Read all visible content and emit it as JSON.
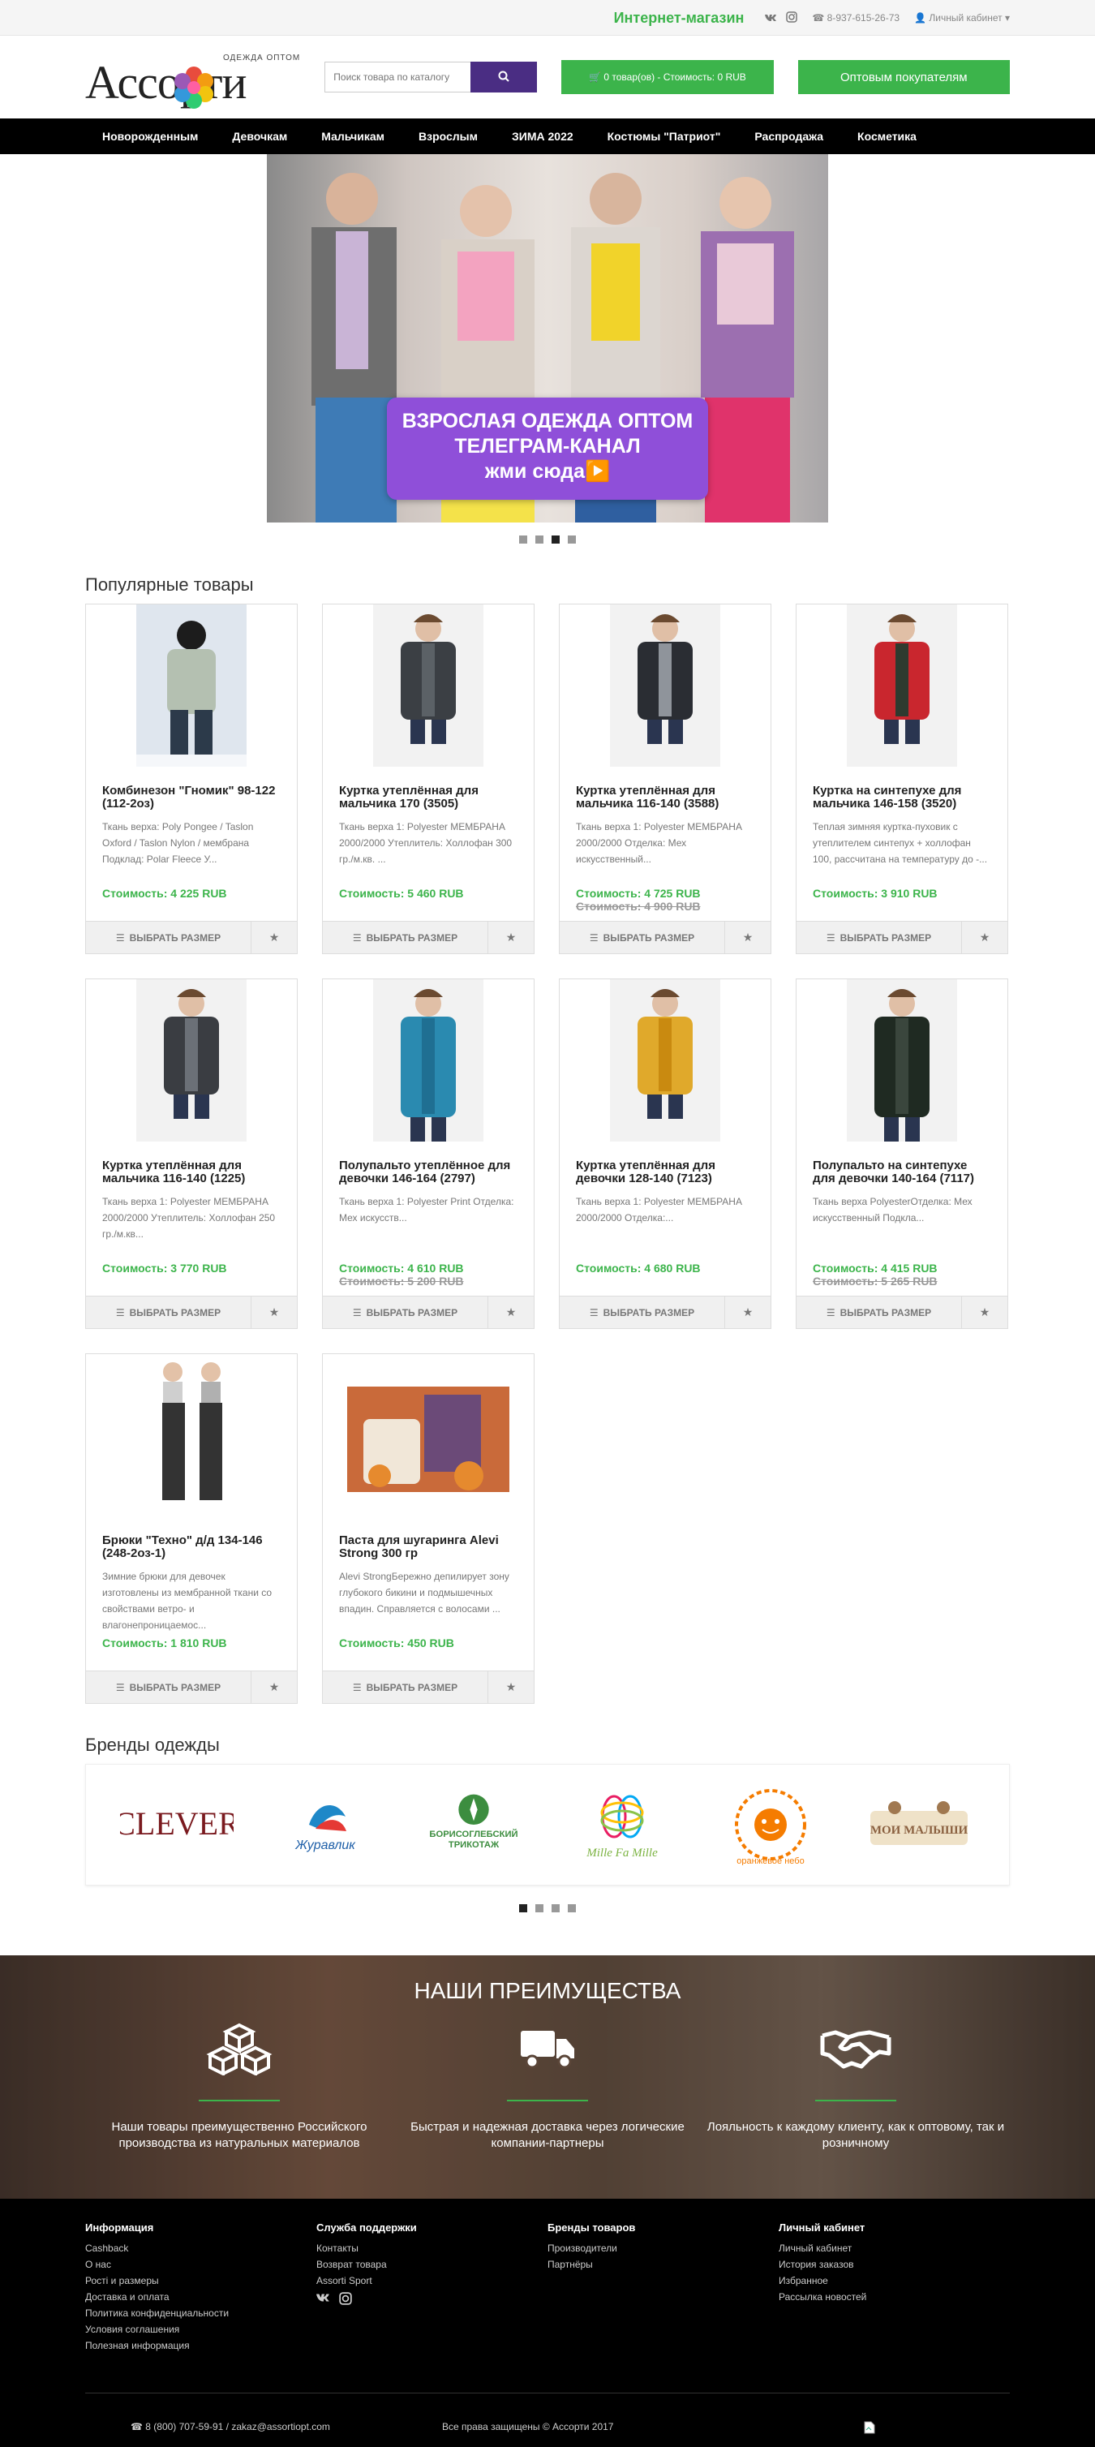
{
  "topbar": {
    "shop_title": "Интернет-магазин",
    "phone": "8-937-615-26-73",
    "cabinet": "Личный кабинет"
  },
  "header": {
    "logo_main": "Ассорти",
    "logo_sub": "ОДЕЖДА ОПТОМ",
    "search_placeholder": "Поиск товара по каталогу",
    "cart": "0 товар(ов) - Стоимость: 0 RUB",
    "wholesale": "Оптовым покупателям"
  },
  "nav": [
    "Новорожденным",
    "Девочкам",
    "Мальчикам",
    "Взрослым",
    "ЗИМА 2022",
    "Костюмы \"Патриот\"",
    "Распродажа",
    "Косметика"
  ],
  "banner": {
    "line1": "ВЗРОСЛАЯ ОДЕЖДА ОПТОМ",
    "line2": "ТЕЛЕГРАМ-КАНАЛ",
    "line3": "жми сюда▶️",
    "slide_count": 4,
    "active_slide": 3
  },
  "popular": {
    "title": "Популярные товары",
    "pick_label": "ВЫБРАТЬ РАЗМЕР",
    "products": [
      {
        "title": "Комбинезон \"Гномик\" 98-122 (112-2оз)",
        "desc": "Ткань верха: Poly Pongee / Taslon Oxford / Taslon Nylon / мембрана Подклад: Polar Fleece У...",
        "price": "Стоимость: 4 225 RUB",
        "old": ""
      },
      {
        "title": "Куртка утеплённая для мальчика 170 (3505)",
        "desc": "Ткань верха 1: Polyester МЕМБРАНА 2000/2000 Утеплитель: Холлофан 300 гр./м.кв. ...",
        "price": "Стоимость: 5 460 RUB",
        "old": ""
      },
      {
        "title": "Куртка утеплённая для мальчика 116-140 (3588)",
        "desc": "Ткань верха 1: Polyester МЕМБРАНА 2000/2000 Отделка: Мех искусственный...",
        "price": "Стоимость: 4 725 RUB",
        "old": "Стоимость: 4 900 RUB"
      },
      {
        "title": "Куртка на синтепухе для мальчика 146-158 (3520)",
        "desc": "Теплая зимняя куртка-пуховик с утеплителем синтепух + холлофан 100, рассчитана на температуру до -...",
        "price": "Стоимость: 3 910 RUB",
        "old": ""
      },
      {
        "title": "Куртка утеплённая для мальчика 116-140 (1225)",
        "desc": "Ткань верха 1: Polyester МЕМБРАНА 2000/2000 Утеплитель: Холлофан 250 гр./м.кв...",
        "price": "Стоимость: 3 770 RUB",
        "old": ""
      },
      {
        "title": "Полупальто утеплённое для девочки 146-164 (2797)",
        "desc": "Ткань верха 1: Polyester Print Отделка: Мех искусств...",
        "price": "Стоимость: 4 610 RUB",
        "old": "Стоимость: 5 200 RUB"
      },
      {
        "title": "Куртка утеплённая для девочки 128-140 (7123)",
        "desc": "Ткань верха 1: Polyester МЕМБРАНА 2000/2000 Отделка:...",
        "price": "Стоимость: 4 680 RUB",
        "old": ""
      },
      {
        "title": "Полупальто на синтепухе для девочки 140-164 (7117)",
        "desc": "Ткань верха PolyesterОтделка: Мех искусственный Подкла...",
        "price": "Стоимость: 4 415 RUB",
        "old": "Стоимость: 5 265 RUB"
      },
      {
        "title": "Брюки \"Техно\" д/д 134-146 (248-2оз-1)",
        "desc": "Зимние брюки для девочек изготовлены из мембранной ткани со свойствами ветро- и влагонепроницаемос...",
        "price": "Стоимость: 1 810 RUB",
        "old": ""
      },
      {
        "title": "Паста для шугаринга Alevi Strong 300 гр",
        "desc": "Alevi StrongБережно депилирует зону глубокого бикини и подмышечных впадин. Справляется с волосами ...",
        "price": "Стоимость: 450 RUB",
        "old": ""
      }
    ]
  },
  "brands": {
    "title": "Бренды одежды",
    "items": [
      "CLEVER",
      "Журавлик",
      "БОРИСОГЛЕБСКИЙ ТРИКОТАЖ",
      "Mille Fa Mille",
      "оранжевое небо",
      "МОИ МАЛЫШИ"
    ],
    "slide_count": 4,
    "active_slide": 1
  },
  "advantages": {
    "title": "НАШИ ПРЕИМУЩЕСТВА",
    "items": [
      {
        "icon": "cubes-icon",
        "text": "Наши товары преимущественно Российского производства из натуральных материалов"
      },
      {
        "icon": "truck-icon",
        "text": "Быстрая и надежная доставка через логические компании-партнеры"
      },
      {
        "icon": "handshake-icon",
        "text": "Лояльность к каждому клиенту, как к оптовому, так и розничному"
      }
    ]
  },
  "footer": {
    "cols": [
      {
        "title": "Информация",
        "links": [
          "Cashback",
          "О нас",
          "Ростi и размеры",
          "Доставка и оплата",
          "Политика конфиденциальности",
          "Условия соглашения",
          "Полезная информация"
        ]
      },
      {
        "title": "Служба поддержки",
        "links": [
          "Контакты",
          "Возврат товара",
          "Assorti Sport"
        ]
      },
      {
        "title": "Бренды товаров",
        "links": [
          "Производители",
          "Партнёры"
        ]
      },
      {
        "title": "Личный кабинет",
        "links": [
          "Личный кабинет",
          "История заказов",
          "Избранное",
          "Рассылка новостей"
        ]
      }
    ],
    "contacts": "8 (800) 707-59-91 / zakaz@assortiopt.com",
    "copyright": "Все права защищены © Ассорти 2017"
  },
  "colors": {
    "accent": "#3cb44b",
    "search_btn": "#4a2d83",
    "nav_bg": "#000000",
    "cta": "#8f4fd9"
  }
}
